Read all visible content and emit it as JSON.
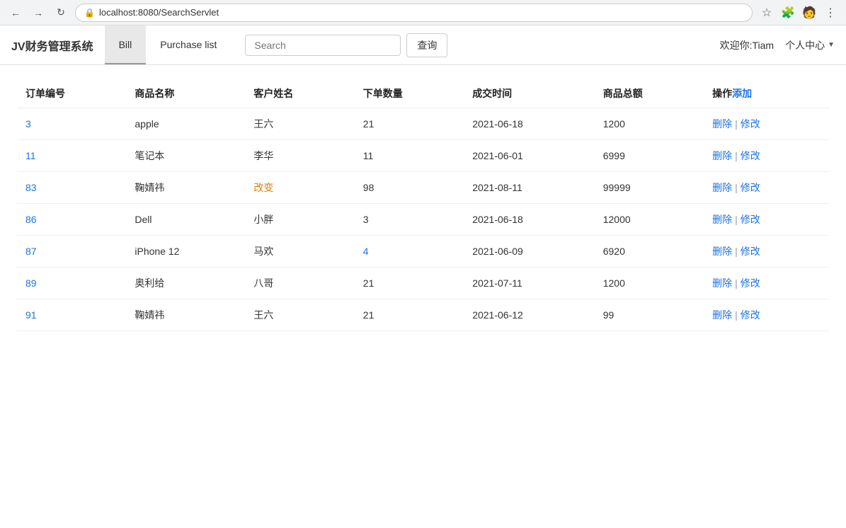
{
  "browser": {
    "url": "localhost:8080/SearchServlet",
    "favicon": "🔒"
  },
  "header": {
    "logo": "JV财务管理系统",
    "tabs": [
      {
        "id": "bill",
        "label": "Bill",
        "active": true
      },
      {
        "id": "purchase",
        "label": "Purchase list",
        "active": false
      }
    ],
    "search_placeholder": "Search",
    "search_btn_label": "查询",
    "welcome": "欢迎你:Tiam",
    "user_center": "个人中心",
    "dropdown_arrow": "▼"
  },
  "table": {
    "columns": [
      {
        "id": "order_id",
        "label": "订单编号"
      },
      {
        "id": "product_name",
        "label": "商品名称"
      },
      {
        "id": "customer_name",
        "label": "客户姓名"
      },
      {
        "id": "quantity",
        "label": "下单数量"
      },
      {
        "id": "deal_time",
        "label": "成交时间"
      },
      {
        "id": "total",
        "label": "商品总额"
      },
      {
        "id": "action",
        "label": "操作",
        "add_label": "添加"
      }
    ],
    "rows": [
      {
        "order_id": "3",
        "product_name": "apple",
        "customer_name": "王六",
        "quantity": "21",
        "deal_time": "2021-06-18",
        "total": "1200",
        "highlight_customer": false,
        "highlight_quantity": false
      },
      {
        "order_id": "11",
        "product_name": "笔记本",
        "customer_name": "李华",
        "quantity": "11",
        "deal_time": "2021-06-01",
        "total": "6999",
        "highlight_customer": false,
        "highlight_quantity": false
      },
      {
        "order_id": "83",
        "product_name": "鞠婧祎",
        "customer_name": "改变",
        "quantity": "98",
        "deal_time": "2021-08-11",
        "total": "99999",
        "highlight_customer": true,
        "highlight_quantity": false
      },
      {
        "order_id": "86",
        "product_name": "Dell",
        "customer_name": "小胖",
        "quantity": "3",
        "deal_time": "2021-06-18",
        "total": "12000",
        "highlight_customer": false,
        "highlight_quantity": false
      },
      {
        "order_id": "87",
        "product_name": "iPhone 12",
        "customer_name": "马欢",
        "quantity": "4",
        "deal_time": "2021-06-09",
        "total": "6920",
        "highlight_customer": false,
        "highlight_quantity": true
      },
      {
        "order_id": "89",
        "product_name": "奥利给",
        "customer_name": "八哥",
        "quantity": "21",
        "deal_time": "2021-07-11",
        "total": "1200",
        "highlight_customer": false,
        "highlight_quantity": false
      },
      {
        "order_id": "91",
        "product_name": "鞠婧祎",
        "customer_name": "王六",
        "quantity": "21",
        "deal_time": "2021-06-12",
        "total": "99",
        "highlight_customer": false,
        "highlight_quantity": false
      }
    ],
    "action_delete": "删除",
    "action_sep": "|",
    "action_edit": "修改"
  }
}
